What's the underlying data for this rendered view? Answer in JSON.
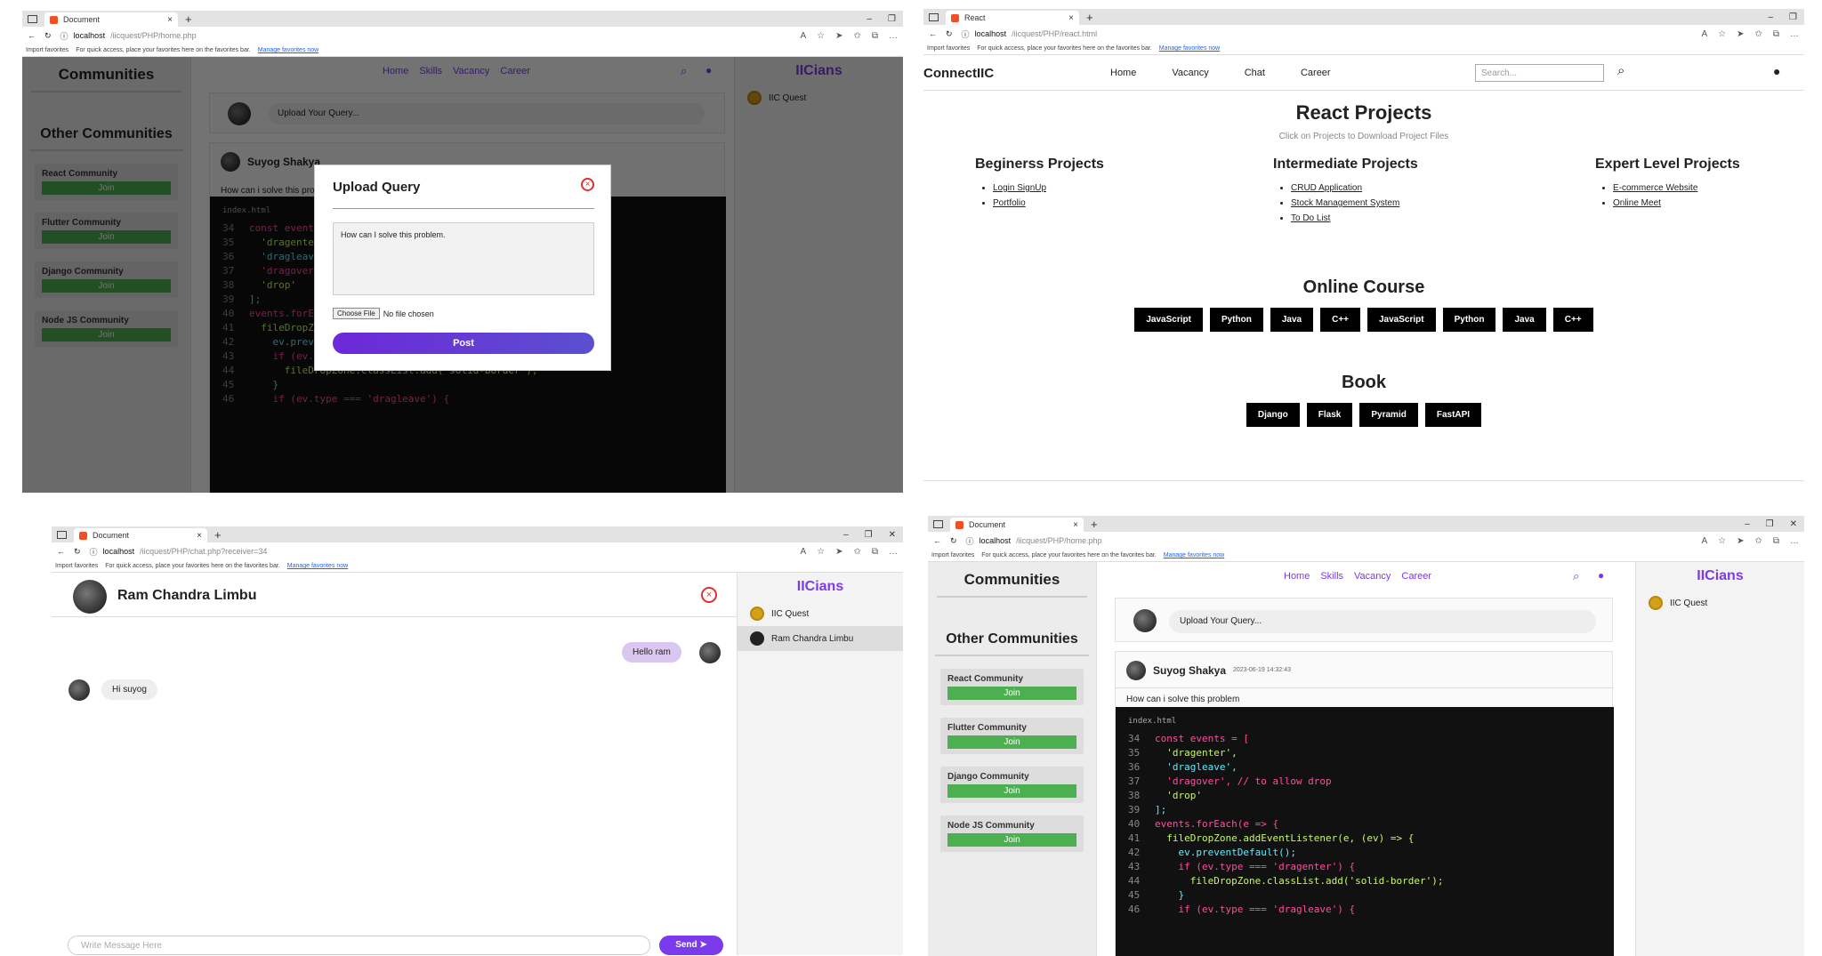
{
  "browser": {
    "tab1": "Document",
    "tab2": "React",
    "favbar_import": "Import favorites",
    "favbar_text": "For quick access, place your favorites here on the favorites bar.",
    "favbar_link": "Manage favorites now"
  },
  "home": {
    "url_host": "localhost",
    "url_path": "/iicquest/PHP/home.php",
    "communities_title": "Communities",
    "other_title": "Other Communities",
    "communities": [
      "React Community",
      "Flutter Community",
      "Django Community",
      "Node JS Community"
    ],
    "join": "Join",
    "nav": [
      "Home",
      "Skills",
      "Vacancy",
      "Career"
    ],
    "upload_placeholder": "Upload Your Query...",
    "right_title": "IICians",
    "users": [
      "IIC Quest"
    ],
    "post_author": "Suyog Shakya",
    "post_time": "2023-06-19 14:32:43",
    "post_text": "How can i solve this problem",
    "tab_file": "index.html"
  },
  "modal": {
    "title": "Upload Query",
    "textarea": "How can I solve this problem.",
    "choose": "Choose File",
    "nofile": "No file chosen",
    "post": "Post"
  },
  "react": {
    "url_host": "localhost",
    "url_path": "/iicquest/PHP/react.html",
    "brand": "ConnectIIC",
    "nav": [
      "Home",
      "Vacancy",
      "Chat",
      "Career"
    ],
    "search_placeholder": "Search...",
    "title": "React Projects",
    "subtitle": "Click on Projects to Download Project Files",
    "col1_title": "Beginerss Projects",
    "col1": [
      "Login SignUp",
      "Portfolio"
    ],
    "col2_title": "Intermediate Projects",
    "col2": [
      "CRUD Application",
      "Stock Management System",
      "To Do List"
    ],
    "col3_title": "Expert Level Projects",
    "col3": [
      "E-commerce Website",
      "Online Meet"
    ],
    "course_title": "Online Course",
    "courses": [
      "JavaScript",
      "Python",
      "Java",
      "C++",
      "JavaScript",
      "Python",
      "Java",
      "C++"
    ],
    "book_title": "Book",
    "books": [
      "Django",
      "Flask",
      "Pyramid",
      "FastAPI"
    ]
  },
  "chat": {
    "url_host": "localhost",
    "url_path": "/iicquest/PHP/chat.php?receiver=34",
    "name": "Ram Chandra Limbu",
    "msg_out": "Hello ram",
    "msg_in": "Hi suyog",
    "input_placeholder": "Write Message Here",
    "send": "Send",
    "right_title": "IICians",
    "users": [
      "IIC Quest",
      "Ram Chandra Limbu"
    ]
  },
  "code_lines": [
    {
      "n": "34",
      "t": "const events = ["
    },
    {
      "n": "35",
      "t": "  'dragenter',"
    },
    {
      "n": "36",
      "t": "  'dragleave',"
    },
    {
      "n": "37",
      "t": "  'dragover', // to allow drop"
    },
    {
      "n": "38",
      "t": "  'drop'"
    },
    {
      "n": "39",
      "t": "];"
    },
    {
      "n": "40",
      "t": "events.forEach(e => {"
    },
    {
      "n": "41",
      "t": "  fileDropZone.addEventListener(e, (ev) => {"
    },
    {
      "n": "42",
      "t": "    ev.preventDefault();"
    },
    {
      "n": "43",
      "t": "    if (ev.type === 'dragenter') {"
    },
    {
      "n": "44",
      "t": "      fileDropZone.classList.add('solid-border');"
    },
    {
      "n": "45",
      "t": "    }"
    },
    {
      "n": "46",
      "t": "    if (ev.type === 'dragleave') {"
    }
  ]
}
